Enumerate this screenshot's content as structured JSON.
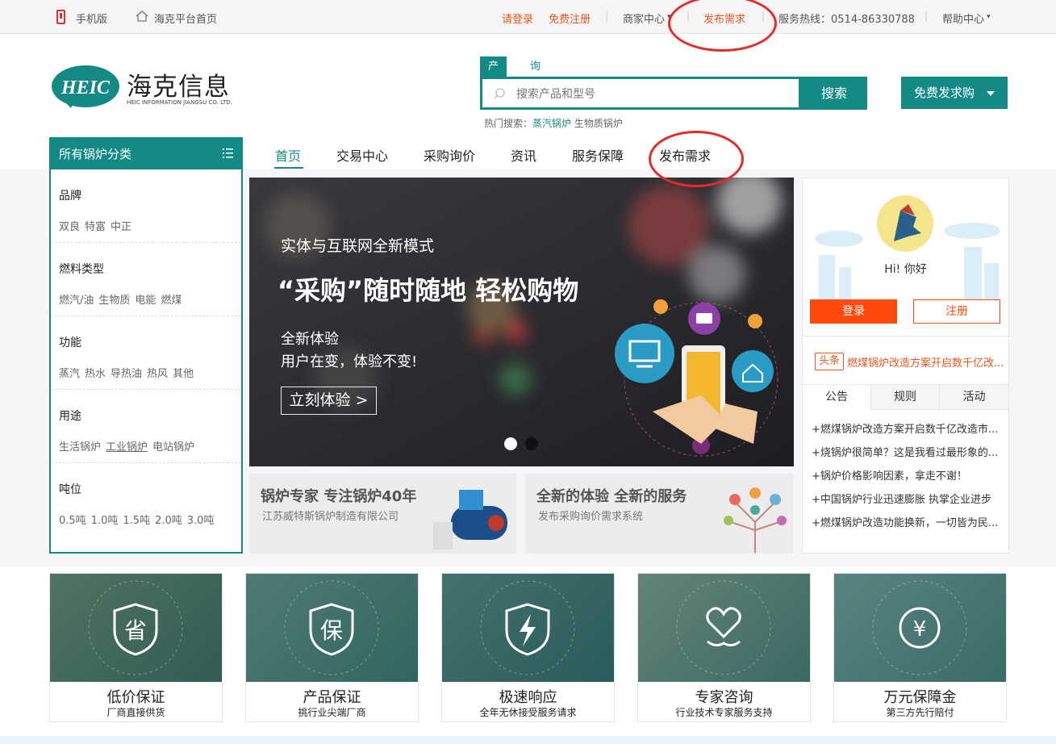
{
  "topbar": {
    "mobile": "手机版",
    "home": "海克平台首页",
    "login": "请登录",
    "register": "免费注册",
    "merchant": "商家中心",
    "publish": "发布需求",
    "hotline": "服务热线：0514-86330788",
    "help": "帮助中心"
  },
  "logo": {
    "cn": "海克信息",
    "en": "HEIC INFORMATION JIANGSU CO. LTD.",
    "mark": "HEIC"
  },
  "search": {
    "tab_product": "产品",
    "tab_inquiry": "询价",
    "placeholder": "搜索产品和型号",
    "button": "搜索",
    "hot_label": "热门搜索：",
    "hot_items": [
      "蒸汽锅炉",
      "生物质锅炉"
    ]
  },
  "free_purchase": "免费发求购",
  "sidebar": {
    "title": "所有锅炉分类",
    "groups": [
      {
        "title": "品牌",
        "items": [
          "双良",
          "特富",
          "中正"
        ]
      },
      {
        "title": "燃料类型",
        "items": [
          "燃汽/油",
          "生物质",
          "电能",
          "燃煤"
        ]
      },
      {
        "title": "功能",
        "items": [
          "蒸汽",
          "热水",
          "导热油",
          "热风",
          "其他"
        ]
      },
      {
        "title": "用途",
        "items": [
          "生活锅炉",
          "工业锅炉",
          "电站锅炉"
        ]
      },
      {
        "title": "吨位",
        "items": [
          "0.5吨",
          "1.0吨",
          "1.5吨",
          "2.0吨",
          "3.0吨"
        ]
      }
    ]
  },
  "nav": [
    "首页",
    "交易中心",
    "采购询价",
    "资讯",
    "服务保障",
    "发布需求"
  ],
  "banner": {
    "line1": "实体与互联网全新模式",
    "line2": "“采购”随时随地 轻松购物",
    "line3": "全新体验",
    "line4": "用户在变，体验不变!",
    "cta": "立刻体验 >"
  },
  "promos": [
    {
      "title": "锅炉专家 专注锅炉40年",
      "sub": "江苏威特斯锅炉制造有限公司"
    },
    {
      "title": "全新的体验 全新的服务",
      "sub": "发布采购询价需求系统"
    }
  ],
  "user_panel": {
    "greeting": "Hi! 你好",
    "login": "登录",
    "register": "注册",
    "headline_tag": "头条",
    "headline": "燃煤锅炉改造方案开启数千亿改..."
  },
  "tabs": [
    "公告",
    "规则",
    "活动"
  ],
  "news": [
    "+燃煤锅炉改造方案开启数千亿改造市...",
    "+烧锅炉很简单？这是我看过最形象的...",
    "+锅炉价格影响因素，拿走不谢！",
    "+中国锅炉行业迅速膨胀 执掌企业进步",
    "+燃煤锅炉改造功能换新，一切皆为民..."
  ],
  "services": [
    {
      "icon": "省",
      "title": "低价保证",
      "sub": "厂商直接供货"
    },
    {
      "icon": "保",
      "title": "产品保证",
      "sub": "挑行业尖端厂商"
    },
    {
      "icon": "lightning",
      "title": "极速响应",
      "sub": "全年无休接受服务请求"
    },
    {
      "icon": "heart",
      "title": "专家咨询",
      "sub": "行业技术专家服务支持"
    },
    {
      "icon": "¥",
      "title": "万元保障金",
      "sub": "第三方先行赔付"
    }
  ],
  "colors": {
    "primary": "#138a86",
    "accent": "#e4571f",
    "login": "#ff4a0d",
    "annotation": "#e32b2b"
  }
}
